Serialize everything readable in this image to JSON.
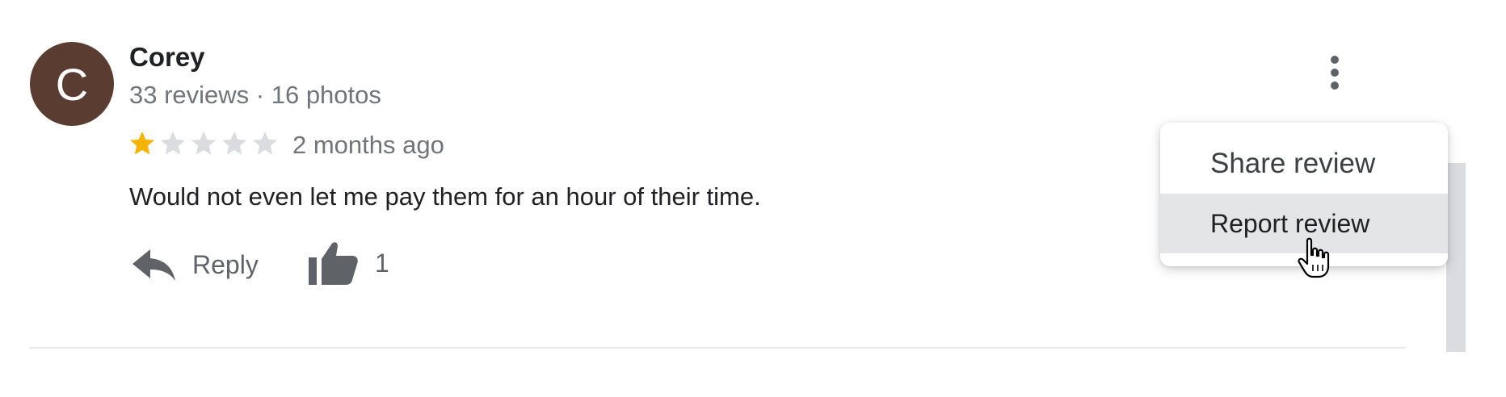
{
  "review": {
    "author": {
      "initial": "C",
      "name": "Corey",
      "meta": "33 reviews · 16 photos",
      "avatar_color": "#5a3c31"
    },
    "rating": {
      "value": 1,
      "max": 5,
      "filled_color": "#f4b400",
      "empty_color": "#dadce0"
    },
    "date": "2 months ago",
    "text": "Would not even let me pay them for an hour of their time.",
    "actions": {
      "reply_label": "Reply",
      "reply_icon": "reply-icon",
      "like_icon": "thumbs-up-icon",
      "like_count": "1"
    },
    "more_icon": "more-vert-icon"
  },
  "menu": {
    "items": [
      {
        "label": "Share review",
        "hovered": false
      },
      {
        "label": "Report review",
        "hovered": true
      }
    ]
  },
  "cursor_icon": "hand-pointer-icon"
}
